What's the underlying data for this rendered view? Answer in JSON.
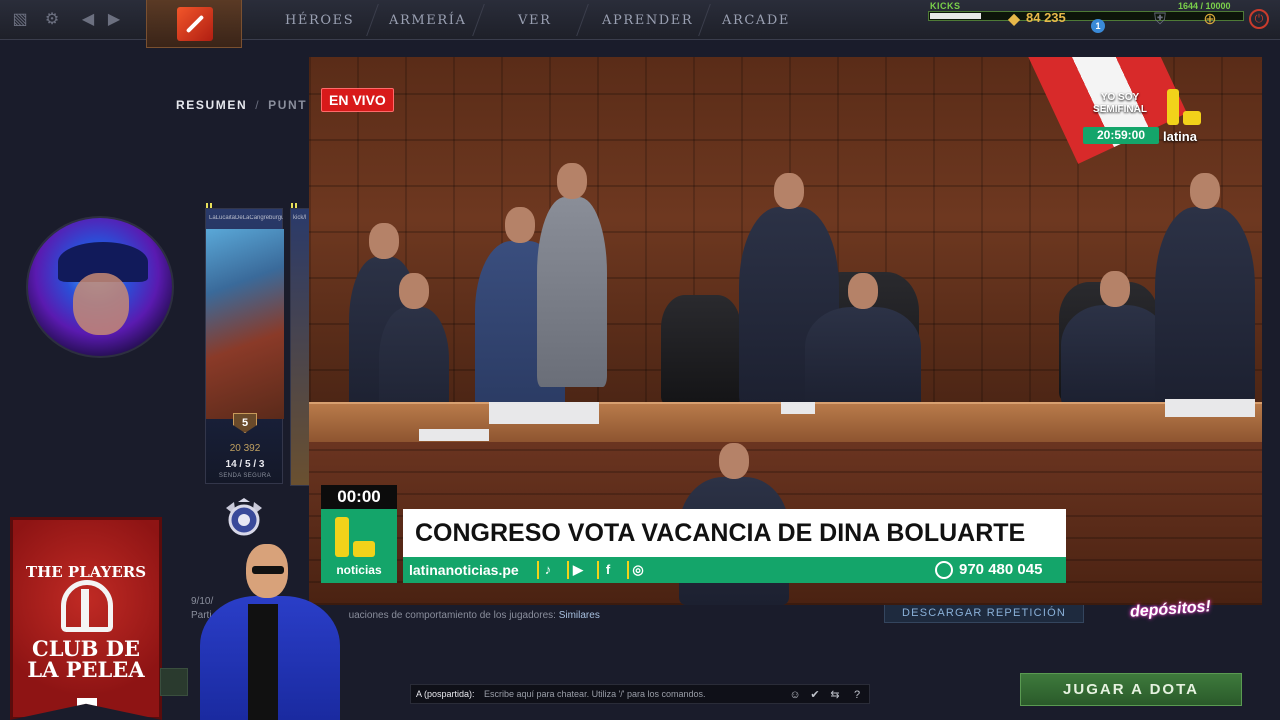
{
  "topbar": {
    "nav": [
      "HÉROES",
      "ARMERÍA",
      "VER",
      "APRENDER",
      "ARCADE"
    ],
    "kicks_label": "KICKS",
    "kicks_count": "1644 / 10000",
    "kicks_progress": 0.164,
    "gold": "84 235",
    "notification_count": "1"
  },
  "profile": {
    "subnav_active": "RESUMEN",
    "subnav_next": "PUNT",
    "hero_card": {
      "player": "LaLucaitaDeLaCangreburguer",
      "level": "5",
      "points": "20 392",
      "kda": "14 / 5 / 3",
      "lane": "SENDA SEGURA"
    },
    "hero_card2_player": "kick/l",
    "date_partial": "9/10/",
    "behavior_prefix": "Parti",
    "behavior_text": "uaciones de comportamiento de los jugadores:",
    "behavior_link": "Similares",
    "download_replay": "DESCARGAR REPETICIÓN"
  },
  "video": {
    "live_label": "EN VIVO",
    "promo_title": "YO SOY SEMIFINAL",
    "promo_time": "20:59:00",
    "channel": "latina",
    "timer": "00:00",
    "lower_logo": "noticias",
    "headline": "CONGRESO VOTA VACANCIA DE DINA BOLUARTE",
    "website": "latinanoticias.pe",
    "phone": "970 480 045"
  },
  "banner": {
    "line1": "THE PLAYERS",
    "line2": "CLUB DE LA PELEA"
  },
  "depositos": "depósitos!",
  "chat": {
    "label": "A (pospartida):",
    "placeholder": "Escribe aquí para chatear. Utiliza '/' para los comandos."
  },
  "play_button": "JUGAR A DOTA",
  "icons": {
    "dota": "dota-logo-icon",
    "settings": "gear-icon",
    "back": "back-arrow-icon",
    "whatsapp": "whatsapp-icon"
  },
  "colors": {
    "accent_green": "#14a56a",
    "latina_yellow": "#f2d21a",
    "live_red": "#d81a1a",
    "play_green": "#3e7a3c"
  }
}
